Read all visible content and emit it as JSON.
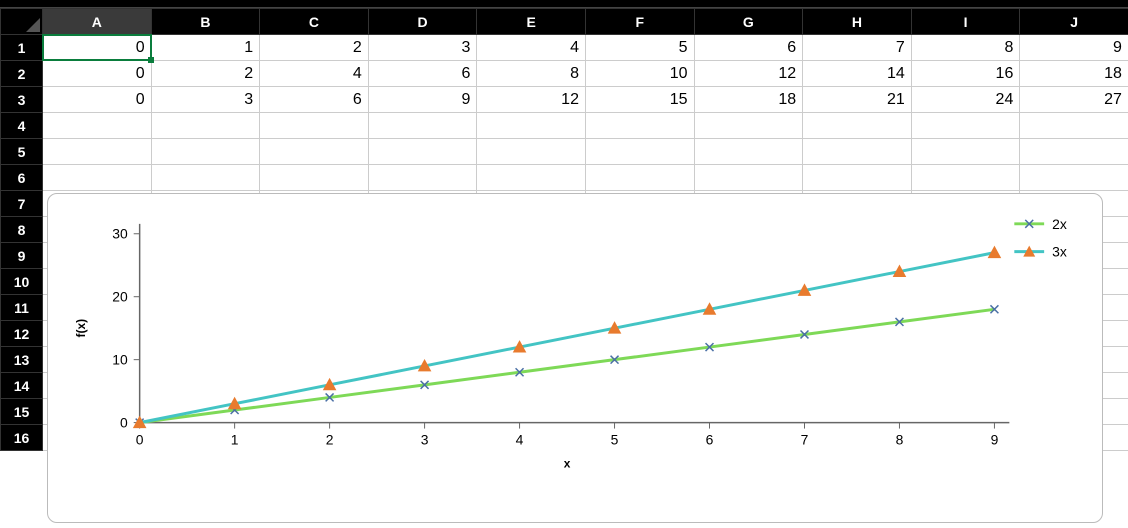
{
  "columns": [
    "A",
    "B",
    "C",
    "D",
    "E",
    "F",
    "G",
    "H",
    "I",
    "J"
  ],
  "row_numbers": [
    1,
    2,
    3,
    4,
    5,
    6,
    7,
    8,
    9,
    10,
    11,
    12,
    13,
    14,
    15,
    16
  ],
  "selected_cell": "A1",
  "cells": {
    "r1": [
      0,
      1,
      2,
      3,
      4,
      5,
      6,
      7,
      8,
      9
    ],
    "r2": [
      0,
      2,
      4,
      6,
      8,
      10,
      12,
      14,
      16,
      18
    ],
    "r3": [
      0,
      3,
      6,
      9,
      12,
      15,
      18,
      21,
      24,
      27
    ]
  },
  "chart_data": {
    "type": "line",
    "xlabel": "x",
    "ylabel": "f(x)",
    "x": [
      0,
      1,
      2,
      3,
      4,
      5,
      6,
      7,
      8,
      9
    ],
    "yticks": [
      0,
      10,
      20,
      30
    ],
    "series": [
      {
        "name": "2x",
        "values": [
          0,
          2,
          4,
          6,
          8,
          10,
          12,
          14,
          16,
          18
        ],
        "color": "#7ed957",
        "marker": "x",
        "marker_color": "#4a6fa5"
      },
      {
        "name": "3x",
        "values": [
          0,
          3,
          6,
          9,
          12,
          15,
          18,
          21,
          24,
          27
        ],
        "color": "#43c4c4",
        "marker": "triangle",
        "marker_color": "#e87b2e"
      }
    ],
    "legend_position": "top-right"
  }
}
